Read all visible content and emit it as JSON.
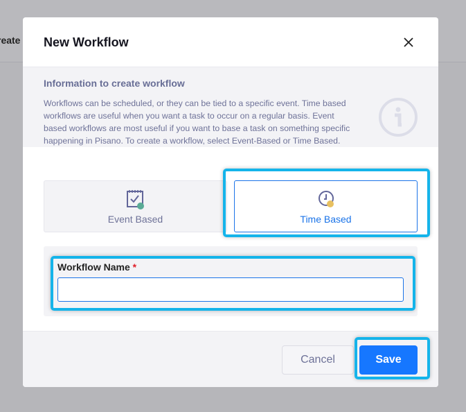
{
  "background": {
    "partial_text": "reate"
  },
  "modal": {
    "title": "New Workflow",
    "info": {
      "heading": "Information to create workflow",
      "text": "Workflows can be scheduled, or they can be tied to a specific event. Time based workflows are useful when you want a task to occur on a regular basis. Event based workflows are most useful if you want to base a task on something specific happening in Pisano. To create a workflow, select Event-Based or Time Based."
    },
    "types": [
      {
        "label": "Event Based",
        "icon": "calendar-check-icon",
        "selected": false
      },
      {
        "label": "Time Based",
        "icon": "clock-icon",
        "selected": true
      }
    ],
    "form": {
      "label": "Workflow Name",
      "required_mark": "*",
      "value": "",
      "placeholder": ""
    },
    "footer": {
      "cancel": "Cancel",
      "save": "Save"
    }
  },
  "colors": {
    "accent": "#1677ff",
    "highlight": "#15b4ea"
  }
}
